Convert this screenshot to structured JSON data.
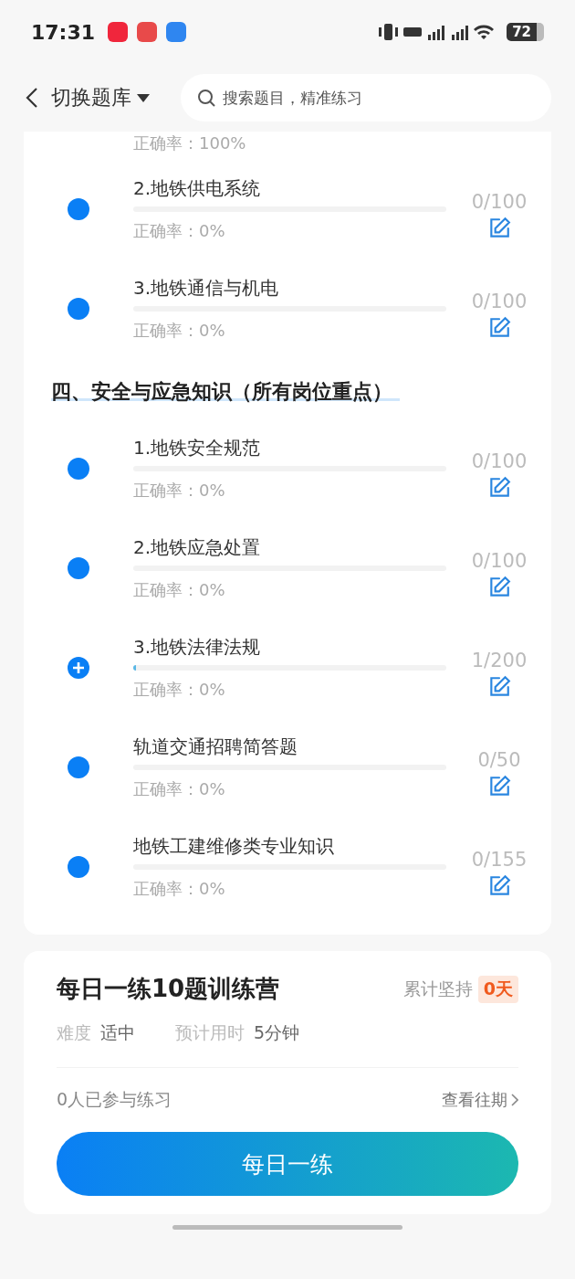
{
  "status_bar": {
    "time": "17:31",
    "battery": "72"
  },
  "nav": {
    "title": "切换题库",
    "search": {
      "placeholder": "搜索题目，精准练习"
    }
  },
  "chapter_list": {
    "partial_item": {
      "accuracy": "正确率：100%"
    },
    "groups": [
      {
        "items": [
          {
            "kind": "dot",
            "title": "2.地铁供电系统",
            "accuracy": "正确率：0%",
            "count": "0/100"
          },
          {
            "kind": "dot",
            "title": "3.地铁通信与机电",
            "accuracy": "正确率：0%",
            "count": "0/100"
          }
        ]
      },
      {
        "heading": "四、安全与应急知识（所有岗位重点）",
        "items": [
          {
            "kind": "dot",
            "title": "1.地铁安全规范",
            "accuracy": "正确率：0%",
            "count": "0/100"
          },
          {
            "kind": "dot",
            "title": "2.地铁应急处置",
            "accuracy": "正确率：0%",
            "count": "0/100"
          },
          {
            "kind": "expand",
            "title": "3.地铁法律法规",
            "level": 0.005,
            "accuracy": "正确率：0%",
            "count": "1/200"
          },
          {
            "kind": "dot",
            "title": "轨道交通招聘简答题",
            "accuracy": "正确率：0%",
            "count": "0/50"
          },
          {
            "kind": "dot",
            "title": "地铁工建维修类专业知识",
            "accuracy": "正确率：0%",
            "count": "0/155"
          }
        ]
      }
    ]
  },
  "daily": {
    "title": "每日一练10题训练营",
    "streak_label": "累计坚持",
    "streak": "0天",
    "meta": [
      {
        "label": "难度",
        "value": "适中"
      },
      {
        "label": "预计用时",
        "value": "5分钟"
      }
    ],
    "participants": "0人已参与练习",
    "history_link": "查看往期",
    "button": "每日一练"
  }
}
